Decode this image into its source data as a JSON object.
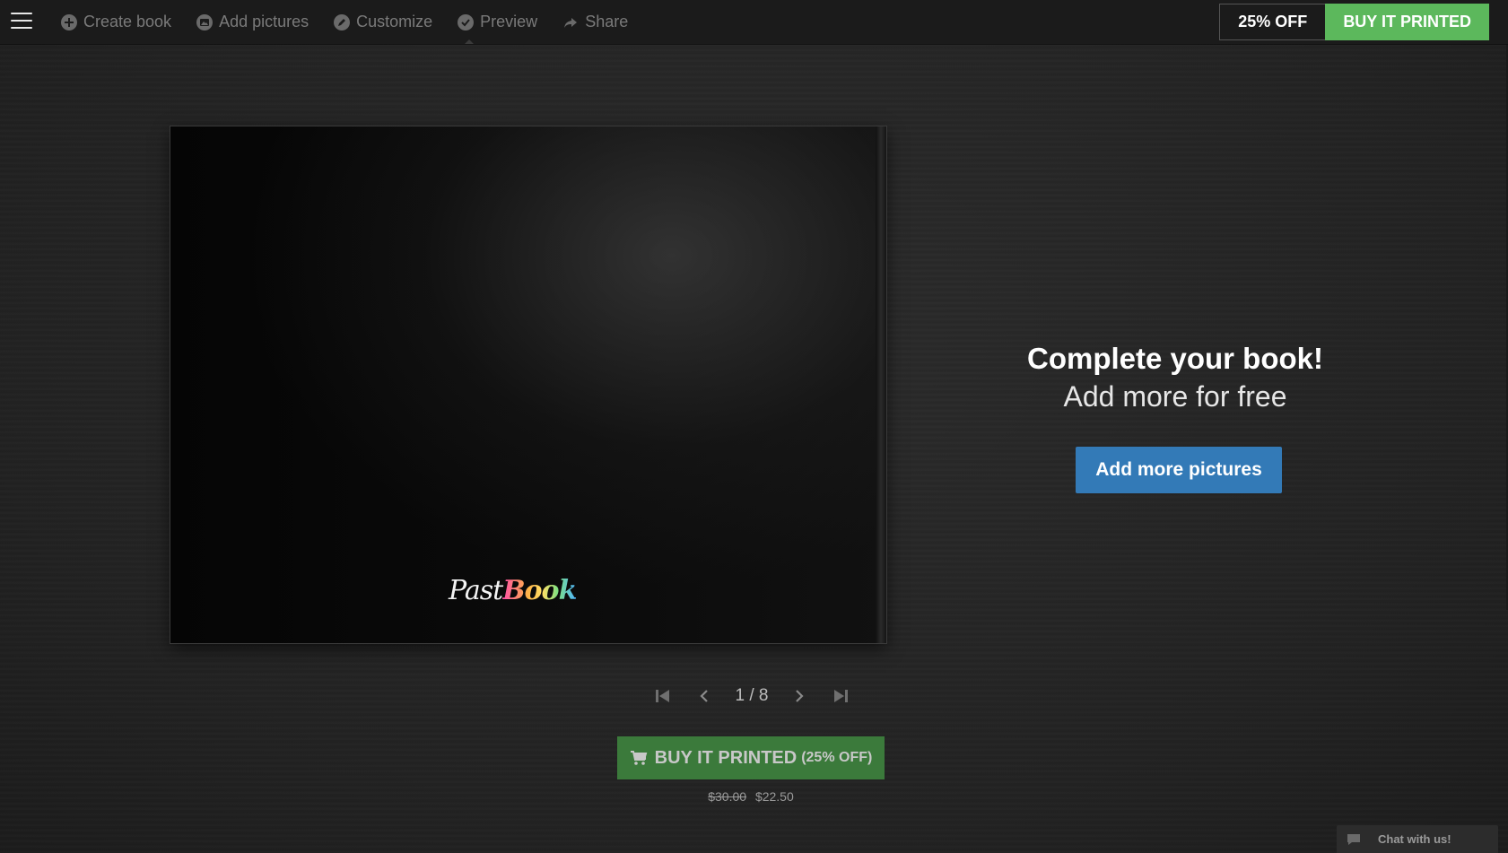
{
  "nav": {
    "items": [
      {
        "label": "Create book",
        "icon": "plus-circle-icon"
      },
      {
        "label": "Add pictures",
        "icon": "picture-circle-icon"
      },
      {
        "label": "Customize",
        "icon": "pencil-circle-icon"
      },
      {
        "label": "Preview",
        "icon": "check-circle-icon"
      },
      {
        "label": "Share",
        "icon": "share-arrow-icon"
      }
    ],
    "active": "Preview"
  },
  "promo": {
    "discount_label": "25% OFF",
    "buy_label": "BUY IT PRINTED"
  },
  "book": {
    "logo_part1": "Past",
    "logo_part2": "Book"
  },
  "pager": {
    "current": "1",
    "separator": " / ",
    "total": "8"
  },
  "buy_bottom": {
    "label": "BUY IT PRINTED",
    "discount": "(25% OFF)",
    "old_price": "$30.00",
    "new_price": "$22.50"
  },
  "cta": {
    "title": "Complete your book!",
    "subtitle": "Add more for free",
    "button": "Add more pictures"
  },
  "chat": {
    "label": "Chat with us!"
  },
  "colors": {
    "green": "#5cb85c",
    "dark_green": "#3b7a3b",
    "blue": "#337ab7",
    "topbar": "#1b1b1b"
  }
}
